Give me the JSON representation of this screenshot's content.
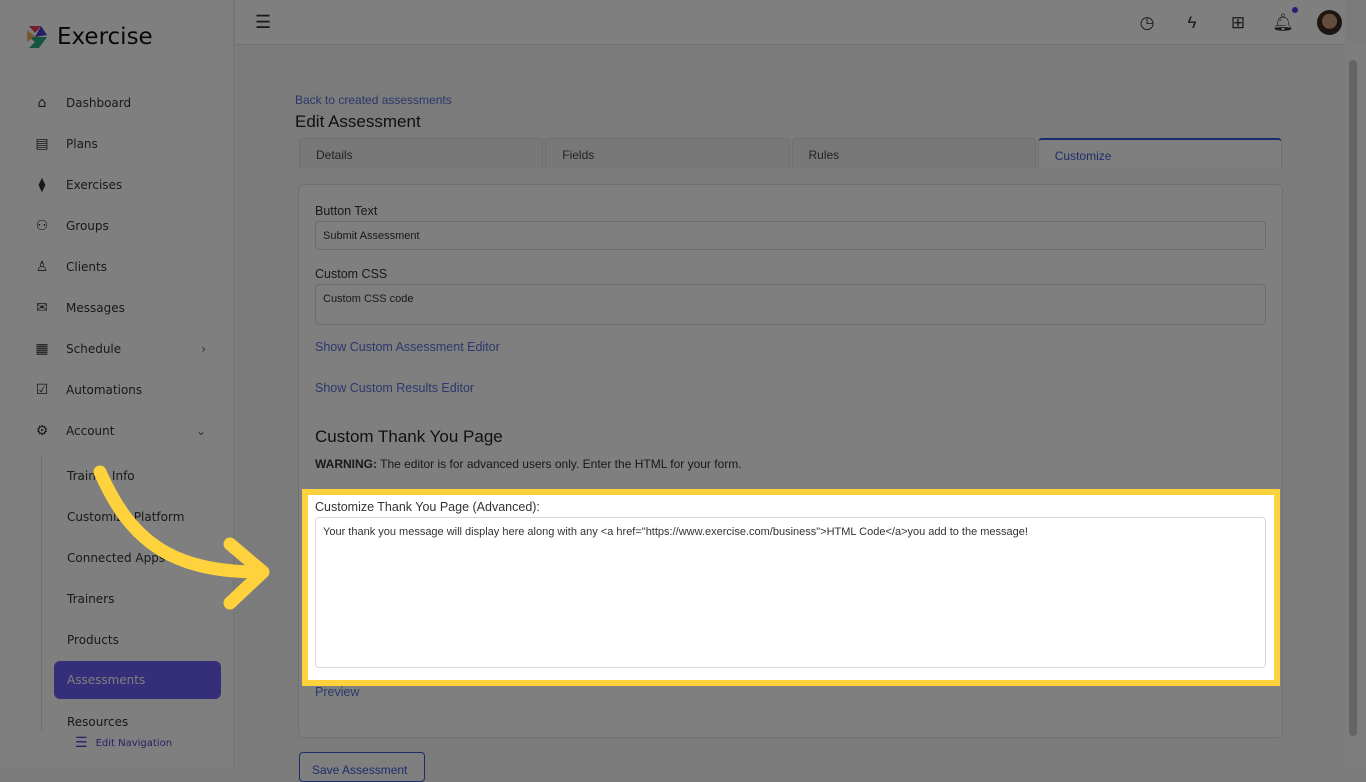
{
  "app": {
    "name": "Exercise"
  },
  "sidebar": {
    "items": [
      {
        "label": "Dashboard",
        "icon": "home-icon"
      },
      {
        "label": "Plans",
        "icon": "clipboard-icon"
      },
      {
        "label": "Exercises",
        "icon": "dumbbell-icon"
      },
      {
        "label": "Groups",
        "icon": "groups-icon"
      },
      {
        "label": "Clients",
        "icon": "user-icon"
      },
      {
        "label": "Messages",
        "icon": "mail-icon"
      },
      {
        "label": "Schedule",
        "icon": "calendar-icon"
      },
      {
        "label": "Automations",
        "icon": "checkbox-icon"
      },
      {
        "label": "Account",
        "icon": "gear-icon"
      }
    ],
    "account_sub": [
      "Trainer Info",
      "Customize Platform",
      "Connected Apps",
      "Trainers",
      "Products",
      "Assessments",
      "Resources"
    ],
    "edit_navigation": "Edit Navigation"
  },
  "header": {
    "icons": [
      "clock-icon",
      "bolt-icon",
      "apps-icon",
      "bell-icon",
      "avatar"
    ]
  },
  "main": {
    "back_link": "Back to created assessments",
    "title": "Edit Assessment",
    "tabs": [
      "Details",
      "Fields",
      "Rules",
      "Customize"
    ],
    "button_text_label": "Button Text",
    "button_text_value": "Submit Assessment",
    "custom_css_label": "Custom CSS",
    "custom_css_placeholder": "Custom CSS code",
    "show_assessment_editor": "Show Custom Assessment Editor",
    "show_results_editor": "Show Custom Results Editor",
    "thank_you_heading": "Custom Thank You Page",
    "warning_label": "WARNING:",
    "warning_text": " The editor is for advanced users only. Enter the HTML for your form.",
    "thank_you_label": "Customize Thank You Page (Advanced):",
    "thank_you_value": "Your thank you message will display here along with any <a href=\"https://www.exercise.com/business\">HTML Code</a>you add to the message!",
    "preview": "Preview",
    "save_button": "Save Assessment"
  },
  "colors": {
    "accent": "#6a5cf0",
    "highlight": "#fdd23c",
    "link": "#5a6fd6"
  }
}
